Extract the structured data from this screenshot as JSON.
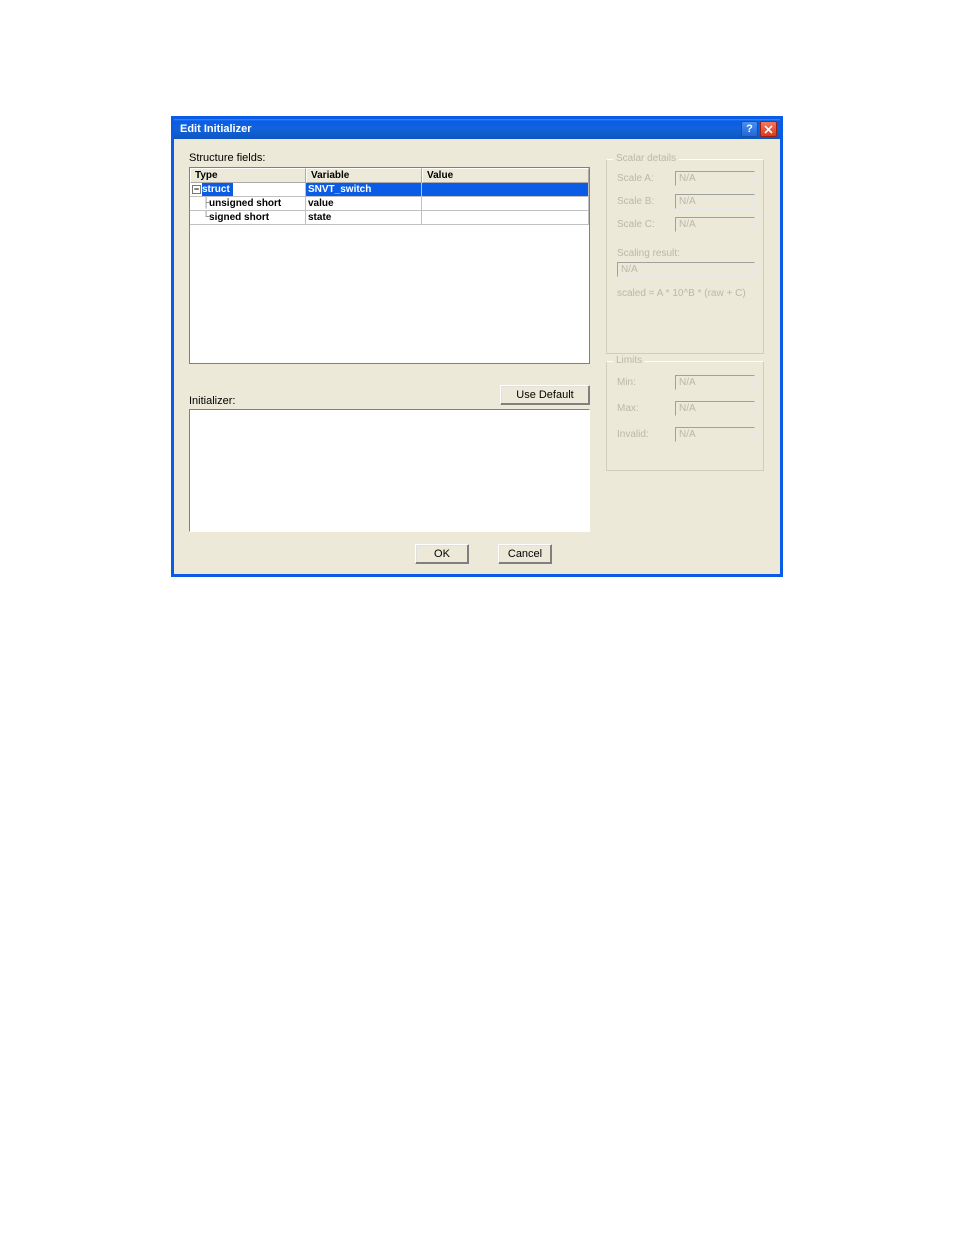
{
  "title": "Edit Initializer",
  "labels": {
    "structure_fields": "Structure fields:",
    "initializer": "Initializer:"
  },
  "buttons": {
    "use_default": "Use Default",
    "ok": "OK",
    "cancel": "Cancel"
  },
  "tree": {
    "headers": {
      "type": "Type",
      "variable": "Variable",
      "value": "Value"
    },
    "rows": [
      {
        "type": "struct",
        "variable": "SNVT_switch",
        "value": "",
        "selected": true,
        "level": 0,
        "expandable": true
      },
      {
        "type": "unsigned short",
        "variable": "value",
        "value": "",
        "selected": false,
        "level": 1,
        "expandable": false
      },
      {
        "type": "signed short",
        "variable": "state",
        "value": "",
        "selected": false,
        "level": 1,
        "expandable": false
      }
    ]
  },
  "initializer_text": "",
  "scalar": {
    "title": "Scalar details",
    "scale_a_label": "Scale A:",
    "scale_a": "N/A",
    "scale_b_label": "Scale B:",
    "scale_b": "N/A",
    "scale_c_label": "Scale C:",
    "scale_c": "N/A",
    "scaling_result_label": "Scaling result:",
    "scaling_result": "N/A",
    "formula": "scaled = A * 10^B * (raw + C)"
  },
  "limits": {
    "title": "Limits",
    "min_label": "Min:",
    "min": "N/A",
    "max_label": "Max:",
    "max": "N/A",
    "invalid_label": "Invalid:",
    "invalid": "N/A"
  }
}
